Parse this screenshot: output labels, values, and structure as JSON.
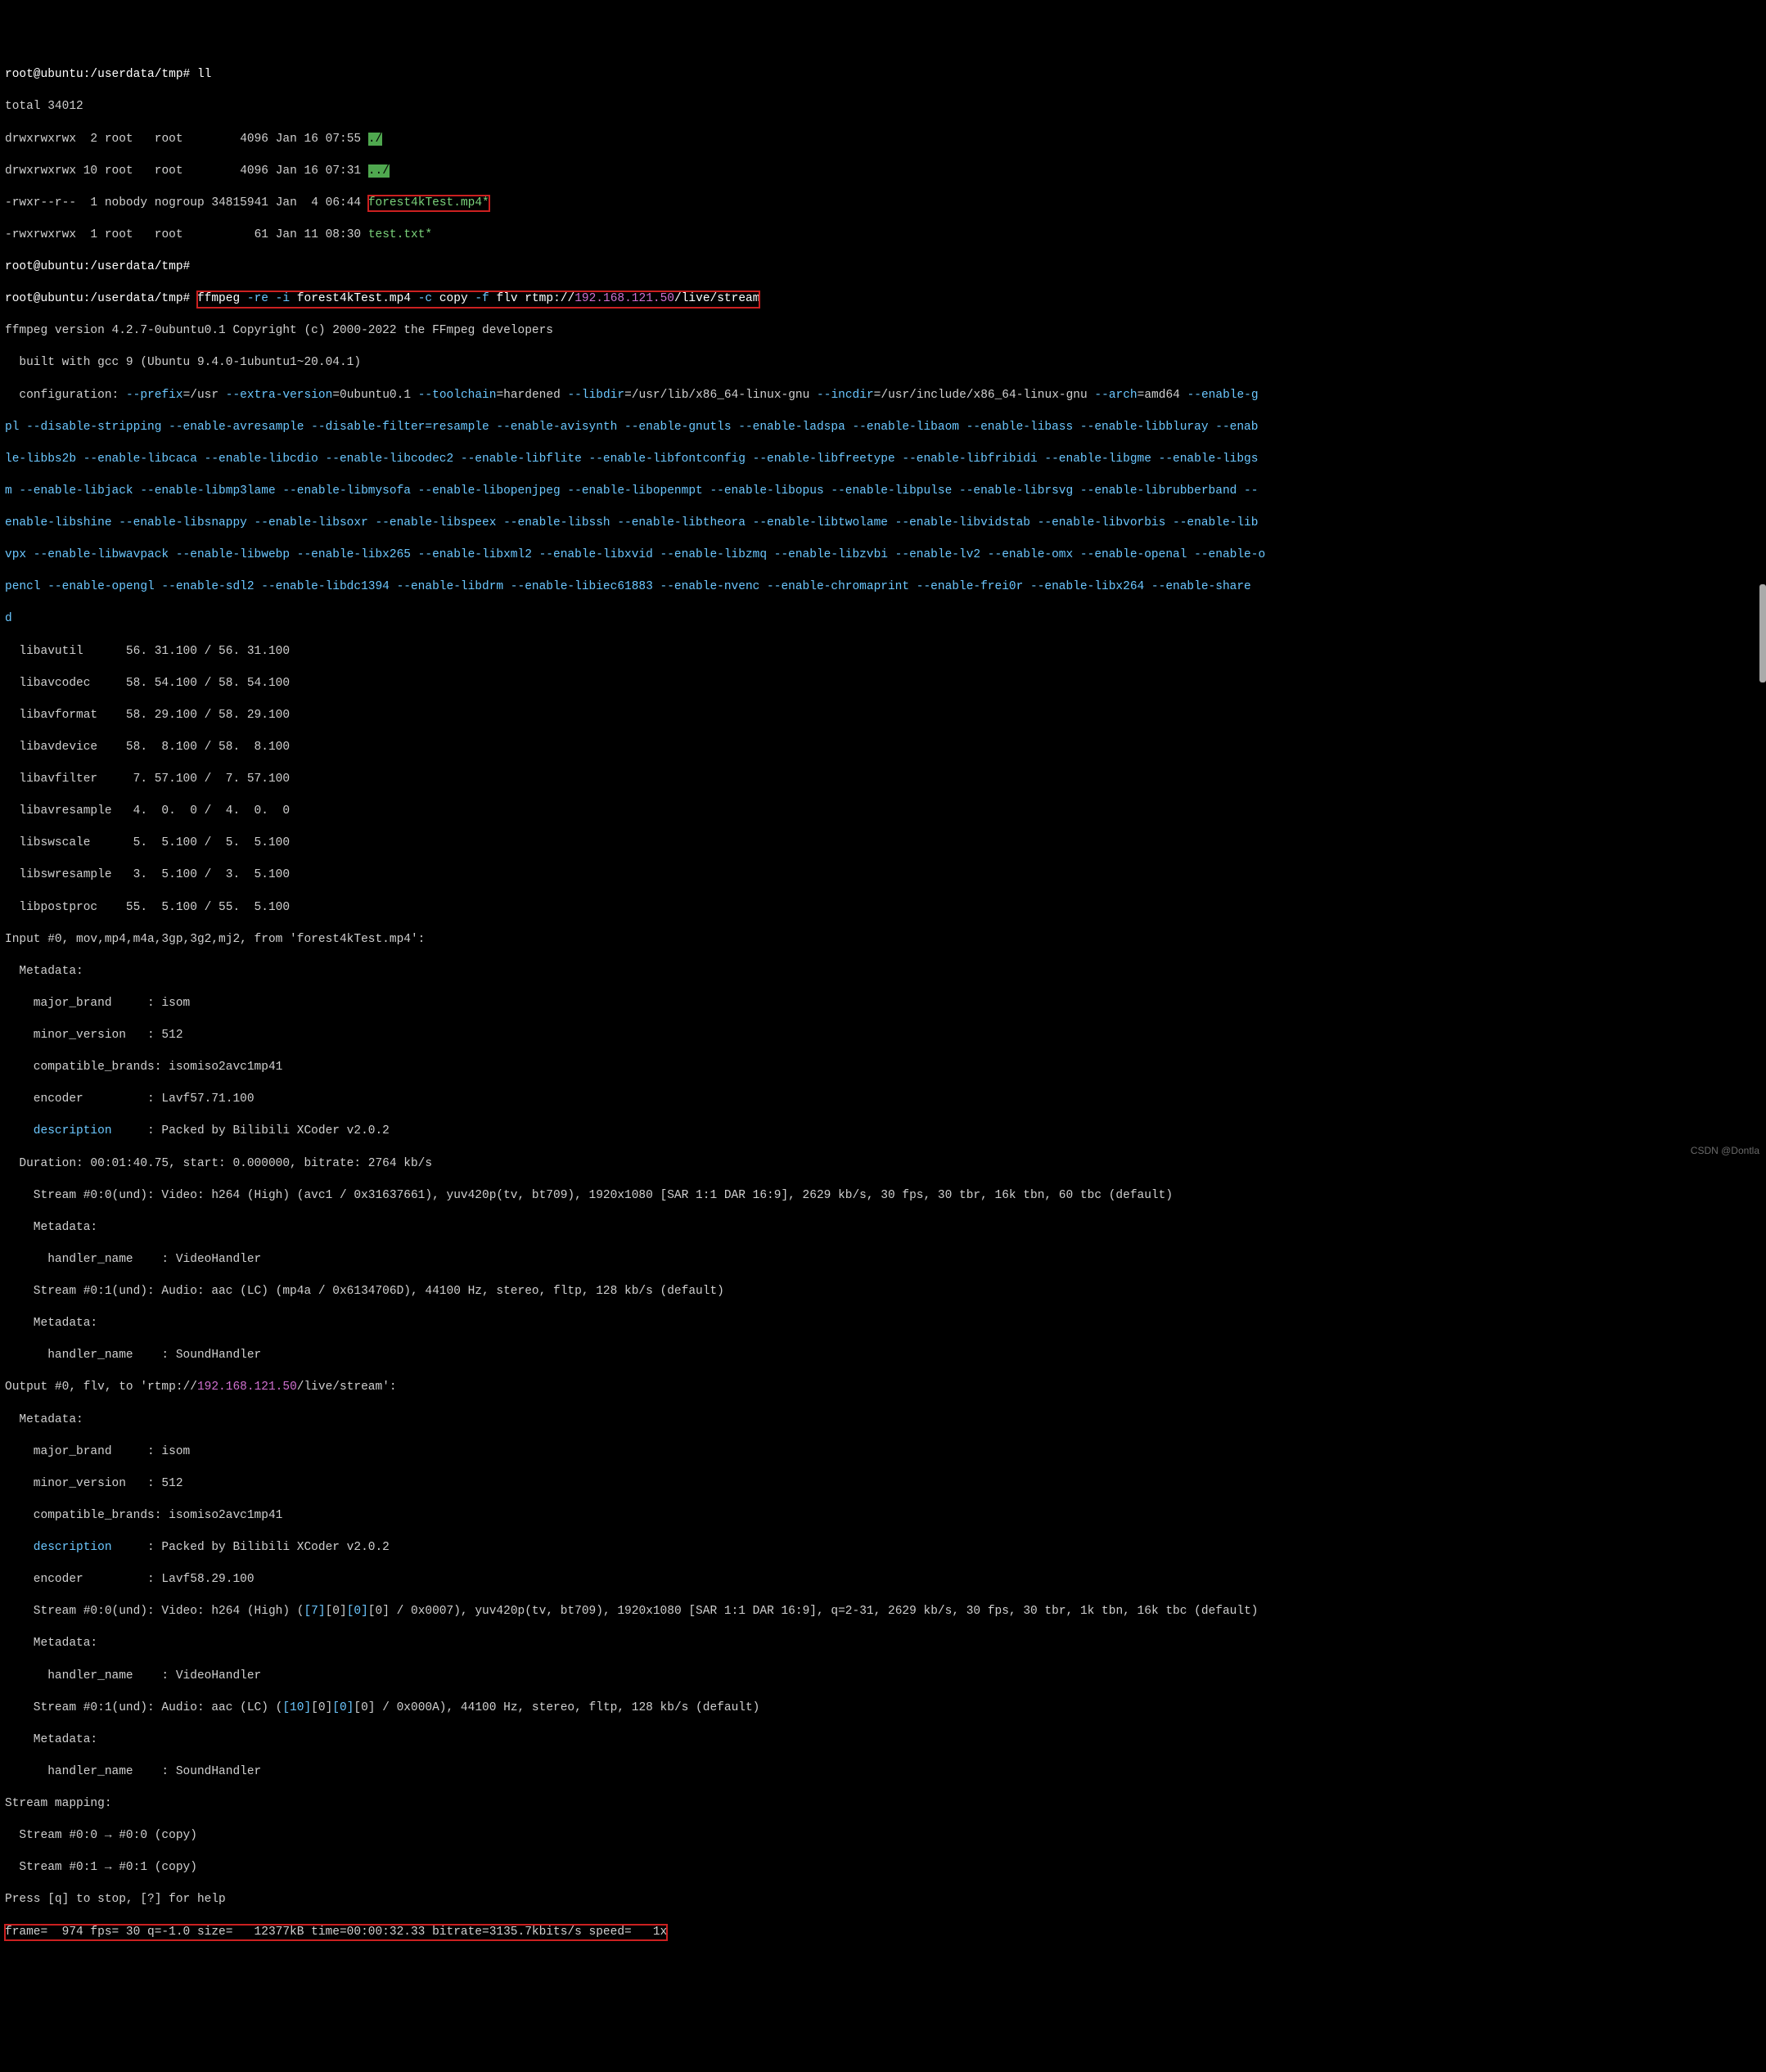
{
  "prompt1": "root@ubuntu:/userdata/tmp# ",
  "cmd_ll": "ll",
  "ls": {
    "total": "total 34012",
    "rows": [
      {
        "perm": "drwxrwxrwx",
        "links": "2",
        "user": "root",
        "group": "root",
        "size": "4096",
        "date": "Jan 16 07:55",
        "name": "./",
        "hl": true
      },
      {
        "perm": "drwxrwxrwx",
        "links": "10",
        "user": "root",
        "group": "root",
        "size": "4096",
        "date": "Jan 16 07:31",
        "name": "../",
        "hl": true
      },
      {
        "perm": "-rwxr--r--",
        "links": "1",
        "user": "nobody",
        "group": "nogroup",
        "size": "34815941",
        "date": "Jan  4 06:44",
        "name": "forest4kTest.mp4*",
        "hl": false,
        "green": true,
        "boxed": true
      },
      {
        "perm": "-rwxrwxrwx",
        "links": "1",
        "user": "root",
        "group": "root",
        "size": "61",
        "date": "Jan 11 08:30",
        "name": "test.txt*",
        "hl": false,
        "green": true
      }
    ]
  },
  "prompt_blank": "root@ubuntu:/userdata/tmp#",
  "ffmpeg_cmd": {
    "pre": "root@ubuntu:/userdata/tmp# ",
    "bin": "ffmpeg",
    "flag_re": " -re -i",
    "file": " forest4kTest.mp4",
    "flag_c": " -c",
    "copy": " copy",
    "flag_f": " -f",
    "flv": " flv rtmp://",
    "ip": "192.168.121.50",
    "tail": "/live/stream"
  },
  "banner": {
    "l1": "ffmpeg version 4.2.7-0ubuntu0.1 Copyright (c) 2000-2022 the FFmpeg developers",
    "l2": "  built with gcc 9 (Ubuntu 9.4.0-1ubuntu1~20.04.1)"
  },
  "config": {
    "l1_a": "  configuration: ",
    "l1_b": "--prefix",
    "l1_c": "=/usr ",
    "l1_d": "--extra-version",
    "l1_e": "=0ubuntu0.1 ",
    "l1_f": "--toolchain",
    "l1_g": "=hardened ",
    "l1_h": "--libdir",
    "l1_i": "=/usr/lib/x86_64-linux-gnu ",
    "l1_j": "--incdir",
    "l1_k": "=/usr/include/x86_64-linux-gnu ",
    "l1_l": "--arch",
    "l1_m": "=amd64 ",
    "l1_n": "--enable-g",
    "l2": "pl --disable-stripping --enable-avresample --disable-filter=resample --enable-avisynth --enable-gnutls --enable-ladspa --enable-libaom --enable-libass --enable-libbluray --enab",
    "l3": "le-libbs2b --enable-libcaca --enable-libcdio --enable-libcodec2 --enable-libflite --enable-libfontconfig --enable-libfreetype --enable-libfribidi --enable-libgme --enable-libgs",
    "l4": "m --enable-libjack --enable-libmp3lame --enable-libmysofa --enable-libopenjpeg --enable-libopenmpt --enable-libopus --enable-libpulse --enable-librsvg --enable-librubberband --",
    "l5": "enable-libshine --enable-libsnappy --enable-libsoxr --enable-libspeex --enable-libssh --enable-libtheora --enable-libtwolame --enable-libvidstab --enable-libvorbis --enable-lib",
    "l6": "vpx --enable-libwavpack --enable-libwebp --enable-libx265 --enable-libxml2 --enable-libxvid --enable-libzmq --enable-libzvbi --enable-lv2 --enable-omx --enable-openal --enable-o",
    "l7": "pencl --enable-opengl --enable-sdl2 --enable-libdc1394 --enable-libdrm --enable-libiec61883 --enable-nvenc --enable-chromaprint --enable-frei0r --enable-libx264 --enable-share",
    "l8": "d"
  },
  "libs": [
    "  libavutil      56. 31.100 / 56. 31.100",
    "  libavcodec     58. 54.100 / 58. 54.100",
    "  libavformat    58. 29.100 / 58. 29.100",
    "  libavdevice    58.  8.100 / 58.  8.100",
    "  libavfilter     7. 57.100 /  7. 57.100",
    "  libavresample   4.  0.  0 /  4.  0.  0",
    "  libswscale      5.  5.100 /  5.  5.100",
    "  libswresample   3.  5.100 /  3.  5.100",
    "  libpostproc    55.  5.100 / 55.  5.100"
  ],
  "input": {
    "head": "Input #0, mov,mp4,m4a,3gp,3g2,mj2, from 'forest4kTest.mp4':",
    "meta": "  Metadata:",
    "mb": "    major_brand     : isom",
    "mv": "    minor_version   : 512",
    "cb": "    compatible_brands: isomiso2avc1mp41",
    "enc": "    encoder         : Lavf57.71.100",
    "desc_k": "    description     ",
    "desc_v": ": Packed by Bilibili XCoder v2.0.2",
    "dur": "  Duration: 00:01:40.75, start: 0.000000, bitrate: 2764 kb/s",
    "s0": "    Stream #0:0(und): Video: h264 (High) (avc1 / 0x31637661), yuv420p(tv, bt709), 1920x1080 [SAR 1:1 DAR 16:9], 2629 kb/s, 30 fps, 30 tbr, 16k tbn, 60 tbc (default)",
    "m0": "    Metadata:",
    "h0": "      handler_name    : VideoHandler",
    "s1": "    Stream #0:1(und): Audio: aac (LC) (mp4a / 0x6134706D), 44100 Hz, stereo, fltp, 128 kb/s (default)",
    "m1": "    Metadata:",
    "h1": "      handler_name    : SoundHandler"
  },
  "output": {
    "head_a": "Output #0, flv, to 'rtmp://",
    "head_ip": "192.168.121.50",
    "head_b": "/live/stream':",
    "meta": "  Metadata:",
    "mb": "    major_brand     : isom",
    "mv": "    minor_version   : 512",
    "cb": "    compatible_brands: isomiso2avc1mp41",
    "desc_k": "    description     ",
    "desc_v": ": Packed by Bilibili XCoder v2.0.2",
    "enc": "    encoder         : Lavf58.29.100",
    "s0_a": "    Stream #0:0(und): Video: h264 (High) (",
    "s0_seven": "[7]",
    "s0_b": "[0]",
    "s0_c": "[0]",
    "s0_d": "[0] / 0x0007), yuv420p(tv, bt709), 1920x1080 [SAR 1:1 DAR 16:9], q=2-31, 2629 kb/s, 30 fps, 30 tbr, 1k tbn, 16k tbc (default)",
    "m0": "    Metadata:",
    "h0": "      handler_name    : VideoHandler",
    "s1_a": "    Stream #0:1(und): Audio: aac (LC) (",
    "s1_ten": "[10]",
    "s1_b": "[0]",
    "s1_c": "[0]",
    "s1_d": "[0] / 0x000A), 44100 Hz, stereo, fltp, 128 kb/s (default)",
    "m1": "    Metadata:",
    "h1": "      handler_name    : SoundHandler"
  },
  "mapping": {
    "head": "Stream mapping:",
    "l1": "  Stream #0:0 → #0:0 (copy)",
    "l2": "  Stream #0:1 → #0:1 (copy)"
  },
  "press": "Press [q] to stop, [?] for help",
  "status": "frame=  974 fps= 30 q=-1.0 size=   12377kB time=00:00:32.33 bitrate=3135.7kbits/s speed=   1x",
  "watermark": "CSDN @Dontla"
}
